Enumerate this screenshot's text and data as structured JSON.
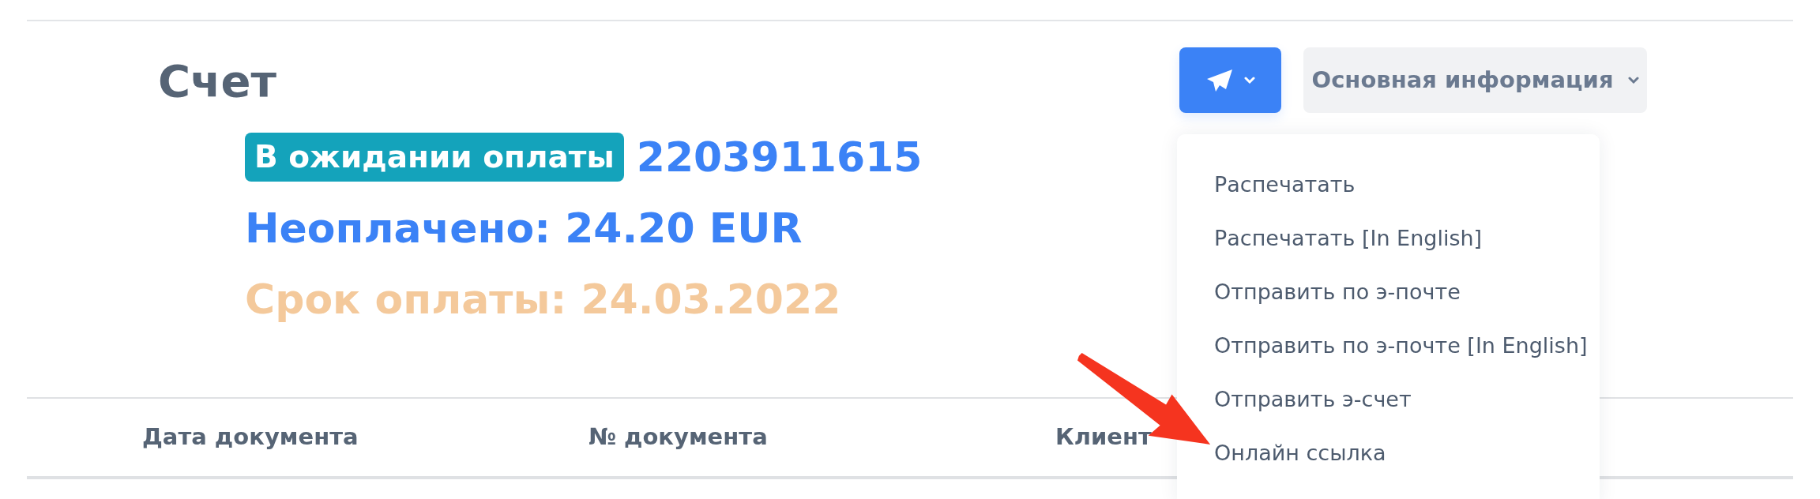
{
  "title": "Счет",
  "status_badge": "В ожидании оплаты",
  "invoice_number": "2203911615",
  "unpaid": "Неоплачено: 24.20 EUR",
  "due_date": "Срок оплаты: 24.03.2022",
  "send_menu": {
    "expanded": true,
    "items": [
      {
        "label": "Распечатать"
      },
      {
        "label": "Распечатать [In English]"
      },
      {
        "label": "Отправить по э-почте"
      },
      {
        "label": "Отправить по э-почте [In English]"
      },
      {
        "label": "Отправить э-счет"
      },
      {
        "label": "Онлайн ссылка"
      }
    ]
  },
  "info_button": {
    "label": "Основная информация",
    "expanded": false
  },
  "table": {
    "columns": [
      "Дата документа",
      "№ документа",
      "Клиент"
    ]
  }
}
